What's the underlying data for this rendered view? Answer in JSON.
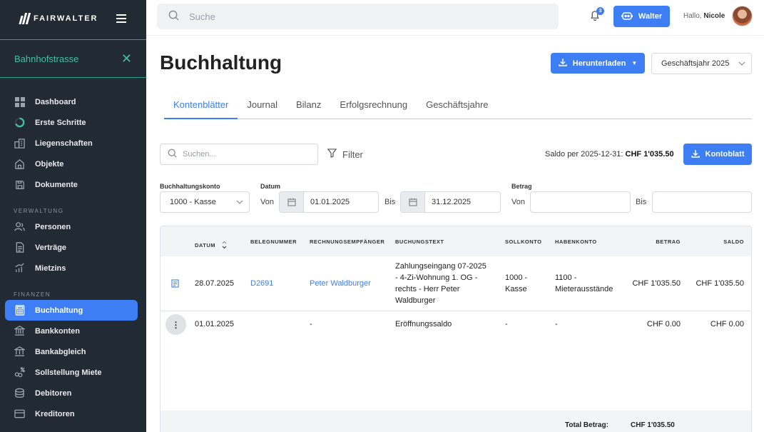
{
  "sidebar": {
    "brand": "FAIRWALTER",
    "property": "Bahnhofstrasse",
    "items_main": [
      {
        "label": "Dashboard"
      },
      {
        "label": "Erste Schritte"
      },
      {
        "label": "Liegenschaften"
      },
      {
        "label": "Objekte"
      },
      {
        "label": "Dokumente"
      }
    ],
    "section_verwaltung": "VERWALTUNG",
    "items_verwaltung": [
      {
        "label": "Personen"
      },
      {
        "label": "Verträge"
      },
      {
        "label": "Mietzins"
      }
    ],
    "section_finanzen": "FINANZEN",
    "items_finanzen": [
      {
        "label": "Buchhaltung"
      },
      {
        "label": "Bankkonten"
      },
      {
        "label": "Bankabgleich"
      },
      {
        "label": "Sollstellung Miete"
      },
      {
        "label": "Debitoren"
      },
      {
        "label": "Kreditoren"
      }
    ]
  },
  "topbar": {
    "search_placeholder": "Suche",
    "notification_count": "3",
    "walter_label": "Walter",
    "greeting": "Hallo,",
    "user_name": "Nicole"
  },
  "page": {
    "title": "Buchhaltung",
    "download_label": "Herunterladen",
    "year_select": "Geschäftsjahr 2025"
  },
  "tabs": [
    {
      "label": "Kontenblätter"
    },
    {
      "label": "Journal"
    },
    {
      "label": "Bilanz"
    },
    {
      "label": "Erfolgsrechnung"
    },
    {
      "label": "Geschäftsjahre"
    }
  ],
  "toolbar": {
    "search_placeholder": "Suchen...",
    "filter_label": "Filter",
    "saldo_prefix": "Saldo per 2025-12-31:",
    "saldo_value": "CHF 1'035.50",
    "kontoblatt_label": "Kontoblatt"
  },
  "filters": {
    "konto_label": "Buchhaltungskonto",
    "konto_value": "1000 - Kasse",
    "datum_label": "Datum",
    "von": "Von",
    "bis": "Bis",
    "date_from": "01.01.2025",
    "date_to": "31.12.2025",
    "betrag_label": "Betrag"
  },
  "table": {
    "headers": [
      "DATUM",
      "BELEGNUMMER",
      "RECHNUNGSEMPFÄNGER",
      "BUCHUNGSTEXT",
      "SOLLKONTO",
      "HABENKONTO",
      "BETRAG",
      "SALDO"
    ],
    "rows": [
      {
        "datum": "28.07.2025",
        "beleg": "D2691",
        "empfaenger": "Peter Waldburger",
        "text_lines": [
          "Zahlungseingang 07-2025",
          "- 4-Zi-Wohnung 1. OG -",
          "rechts - Herr Peter",
          "Waldburger"
        ],
        "soll_lines": [
          "1000 -",
          "Kasse"
        ],
        "haben_lines": [
          "1100 -",
          "Mieterausstände"
        ],
        "betrag": "CHF 1'035.50",
        "saldo": "CHF 1'035.50"
      },
      {
        "datum": "01.01.2025",
        "beleg": "",
        "empfaenger": "-",
        "text_lines": [
          "Eröffnungssaldo"
        ],
        "soll_lines": [
          "-"
        ],
        "haben_lines": [
          "-"
        ],
        "betrag": "CHF 0.00",
        "saldo": "CHF 0.00"
      }
    ],
    "total_label": "Total Betrag:",
    "total_value": "CHF 1'035.50"
  }
}
